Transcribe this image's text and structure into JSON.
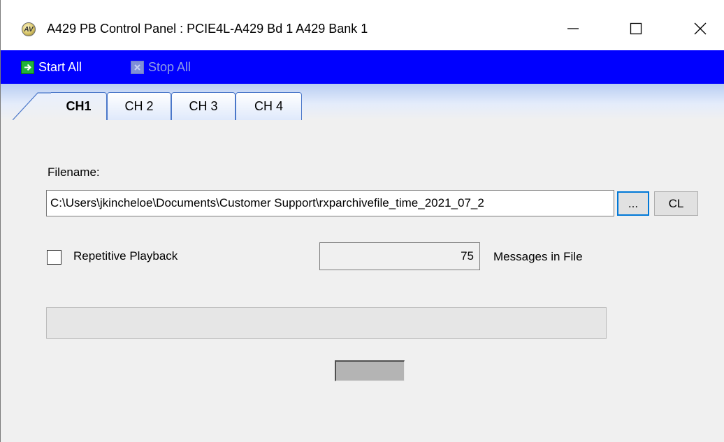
{
  "window": {
    "title": "A429 PB Control Panel : PCIE4L-A429 Bd 1 A429 Bank 1",
    "app_icon": "a429-app-icon",
    "app_icon_text": "AV",
    "controls": [
      "minimize-icon",
      "maximize-icon",
      "close-icon"
    ]
  },
  "toolbar": {
    "start_all_label": "Start All",
    "start_all_icon": "arrow-right-icon",
    "stop_all_label": "Stop All",
    "stop_all_icon": "x-icon",
    "background_color": "#0000ff"
  },
  "tabs": [
    {
      "label": "CH1",
      "active": true
    },
    {
      "label": "CH 2",
      "active": false
    },
    {
      "label": "CH 3",
      "active": false
    },
    {
      "label": "CH 4",
      "active": false
    }
  ],
  "playback": {
    "filename_label": "Filename:",
    "filename_value": "C:\\Users\\jkincheloe\\Documents\\Customer Support\\rxparchivefile_time_2021_07_2",
    "browse_button_label": "...",
    "clear_button_label": "CL",
    "repetitive_label": "Repetitive Playback",
    "repetitive_checked": false,
    "message_count": "75",
    "message_count_label": "Messages in File",
    "progress_fraction": 0
  }
}
